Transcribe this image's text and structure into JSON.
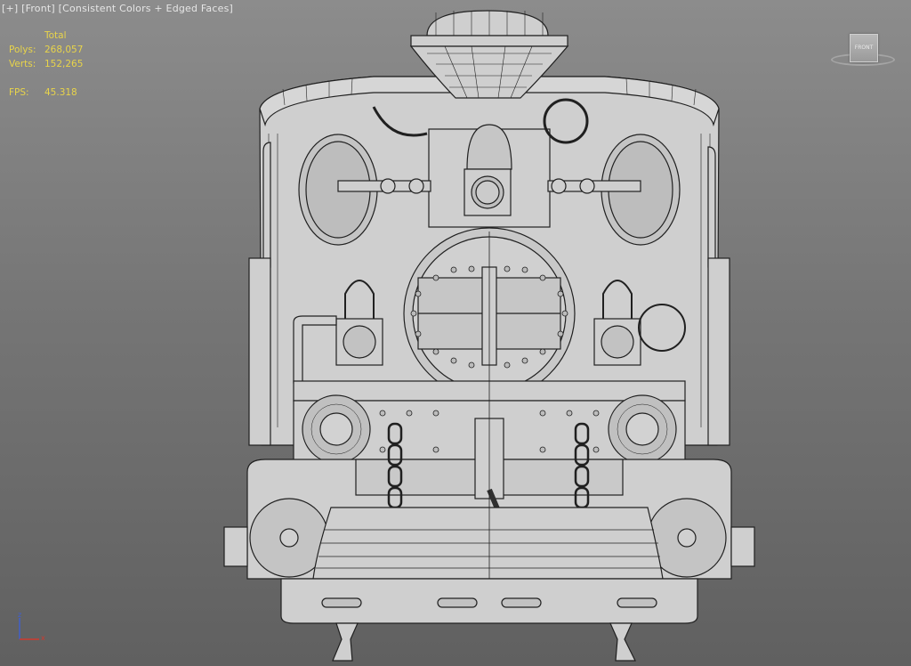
{
  "viewport": {
    "label": {
      "plus": "[+]",
      "view": "[Front]",
      "shading": "[Consistent Colors + Edged Faces]"
    },
    "stats": {
      "header": "Total",
      "polys_label": "Polys:",
      "polys_value": "268,057",
      "verts_label": "Verts:",
      "verts_value": "152,265",
      "fps_label": "FPS:",
      "fps_value": "45.318"
    },
    "viewcube": {
      "face_label": "FRONT"
    },
    "axis": {
      "z": "z",
      "x": "x"
    }
  },
  "colors": {
    "stats_text": "#e8d44a",
    "label_text": "#e6e6e6",
    "model_fill": "#cfcfcf",
    "edge_lines": "#202020",
    "axis_z": "#3f5fd0",
    "axis_x": "#d03a2f"
  },
  "icons": {
    "viewcube": "viewcube-icon",
    "axis_tripod": "axis-tripod-icon"
  }
}
